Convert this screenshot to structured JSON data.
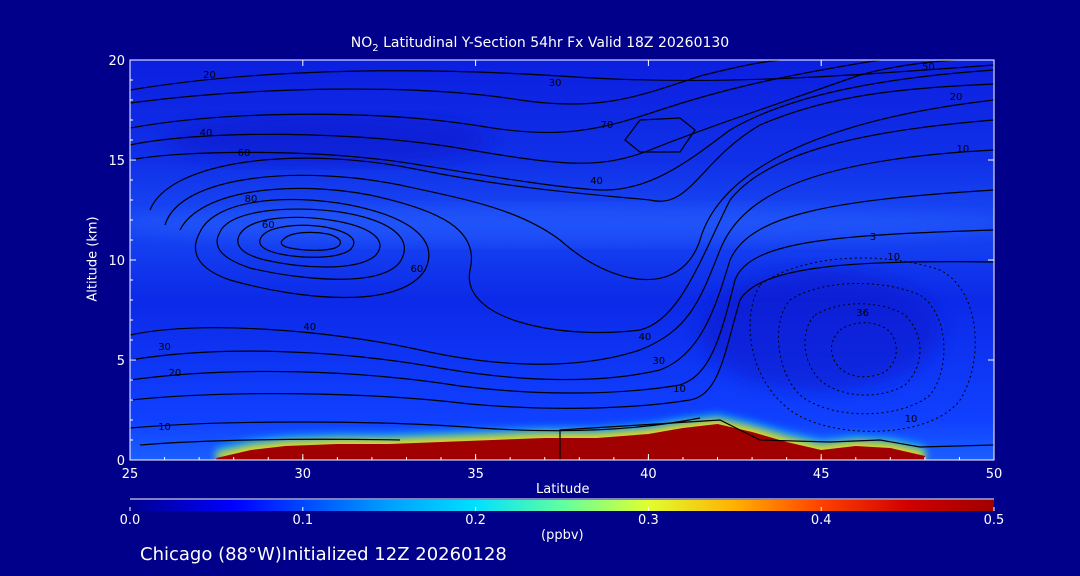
{
  "title_main": "NO",
  "title_sub": "2",
  "title_rest": " Latitudinal Y-Section 54hr  Fx Valid 18Z 20260130",
  "footer": "Chicago (88°W)Initialized 12Z 20260128",
  "colors": {
    "background": "#00008a",
    "field_low": "#0000ff",
    "field_high": "#a00000",
    "contour": "#000000"
  },
  "chart_data": {
    "type": "heatmap",
    "title": "NO2 Latitudinal Y-Section 54hr  Fx Valid 18Z 20260130",
    "xlabel": "Latitude",
    "ylabel": "Altitude (km)",
    "xlim": [
      25,
      50
    ],
    "ylim": [
      0,
      20
    ],
    "xticks": [
      "25",
      "30",
      "35",
      "40",
      "45",
      "50"
    ],
    "yticks": [
      "0",
      "5",
      "10",
      "15",
      "20"
    ],
    "colorbar": {
      "label": "(ppbv)",
      "range": [
        0.0,
        0.5
      ],
      "ticks": [
        "0.0",
        "0.1",
        "0.2",
        "0.3",
        "0.4",
        "0.5"
      ]
    },
    "surface_layer": {
      "description_values": "NO2 boundary layer depth (km) vs latitude, values near 0.5 ppbv inside",
      "latitude": [
        27.5,
        28.5,
        29.5,
        31.0,
        32.5,
        34.0,
        35.5,
        37.0,
        38.5,
        40.0,
        41.0,
        42.0,
        43.0,
        44.0,
        45.0,
        46.0,
        47.0,
        48.0
      ],
      "depth_km": [
        0.1,
        0.5,
        0.7,
        0.8,
        0.8,
        0.9,
        1.0,
        1.1,
        1.1,
        1.3,
        1.6,
        1.8,
        1.4,
        0.9,
        0.5,
        0.7,
        0.6,
        0.2
      ]
    },
    "contour_labels": [
      {
        "x": 27.3,
        "y": 19.1,
        "text": "20"
      },
      {
        "x": 27.2,
        "y": 16.2,
        "text": "40"
      },
      {
        "x": 28.3,
        "y": 15.2,
        "text": "60"
      },
      {
        "x": 28.5,
        "y": 12.9,
        "text": "80"
      },
      {
        "x": 29.0,
        "y": 11.6,
        "text": "60"
      },
      {
        "x": 33.3,
        "y": 9.4,
        "text": "60"
      },
      {
        "x": 30.2,
        "y": 6.5,
        "text": "40"
      },
      {
        "x": 26.0,
        "y": 5.5,
        "text": "30"
      },
      {
        "x": 26.3,
        "y": 4.2,
        "text": "20"
      },
      {
        "x": 26.0,
        "y": 1.5,
        "text": "10"
      },
      {
        "x": 37.3,
        "y": 18.7,
        "text": "30"
      },
      {
        "x": 38.5,
        "y": 13.8,
        "text": "40"
      },
      {
        "x": 38.8,
        "y": 16.6,
        "text": "70"
      },
      {
        "x": 39.9,
        "y": 6.0,
        "text": "40"
      },
      {
        "x": 40.3,
        "y": 4.8,
        "text": "30"
      },
      {
        "x": 40.9,
        "y": 3.4,
        "text": "10"
      },
      {
        "x": 48.1,
        "y": 19.5,
        "text": "50"
      },
      {
        "x": 48.9,
        "y": 18.0,
        "text": "20"
      },
      {
        "x": 49.1,
        "y": 15.4,
        "text": "10"
      },
      {
        "x": 46.5,
        "y": 11.0,
        "text": "3"
      },
      {
        "x": 47.1,
        "y": 10.0,
        "text": "10"
      },
      {
        "x": 46.2,
        "y": 7.2,
        "text": "36"
      },
      {
        "x": 47.6,
        "y": 1.9,
        "text": "10"
      }
    ]
  }
}
